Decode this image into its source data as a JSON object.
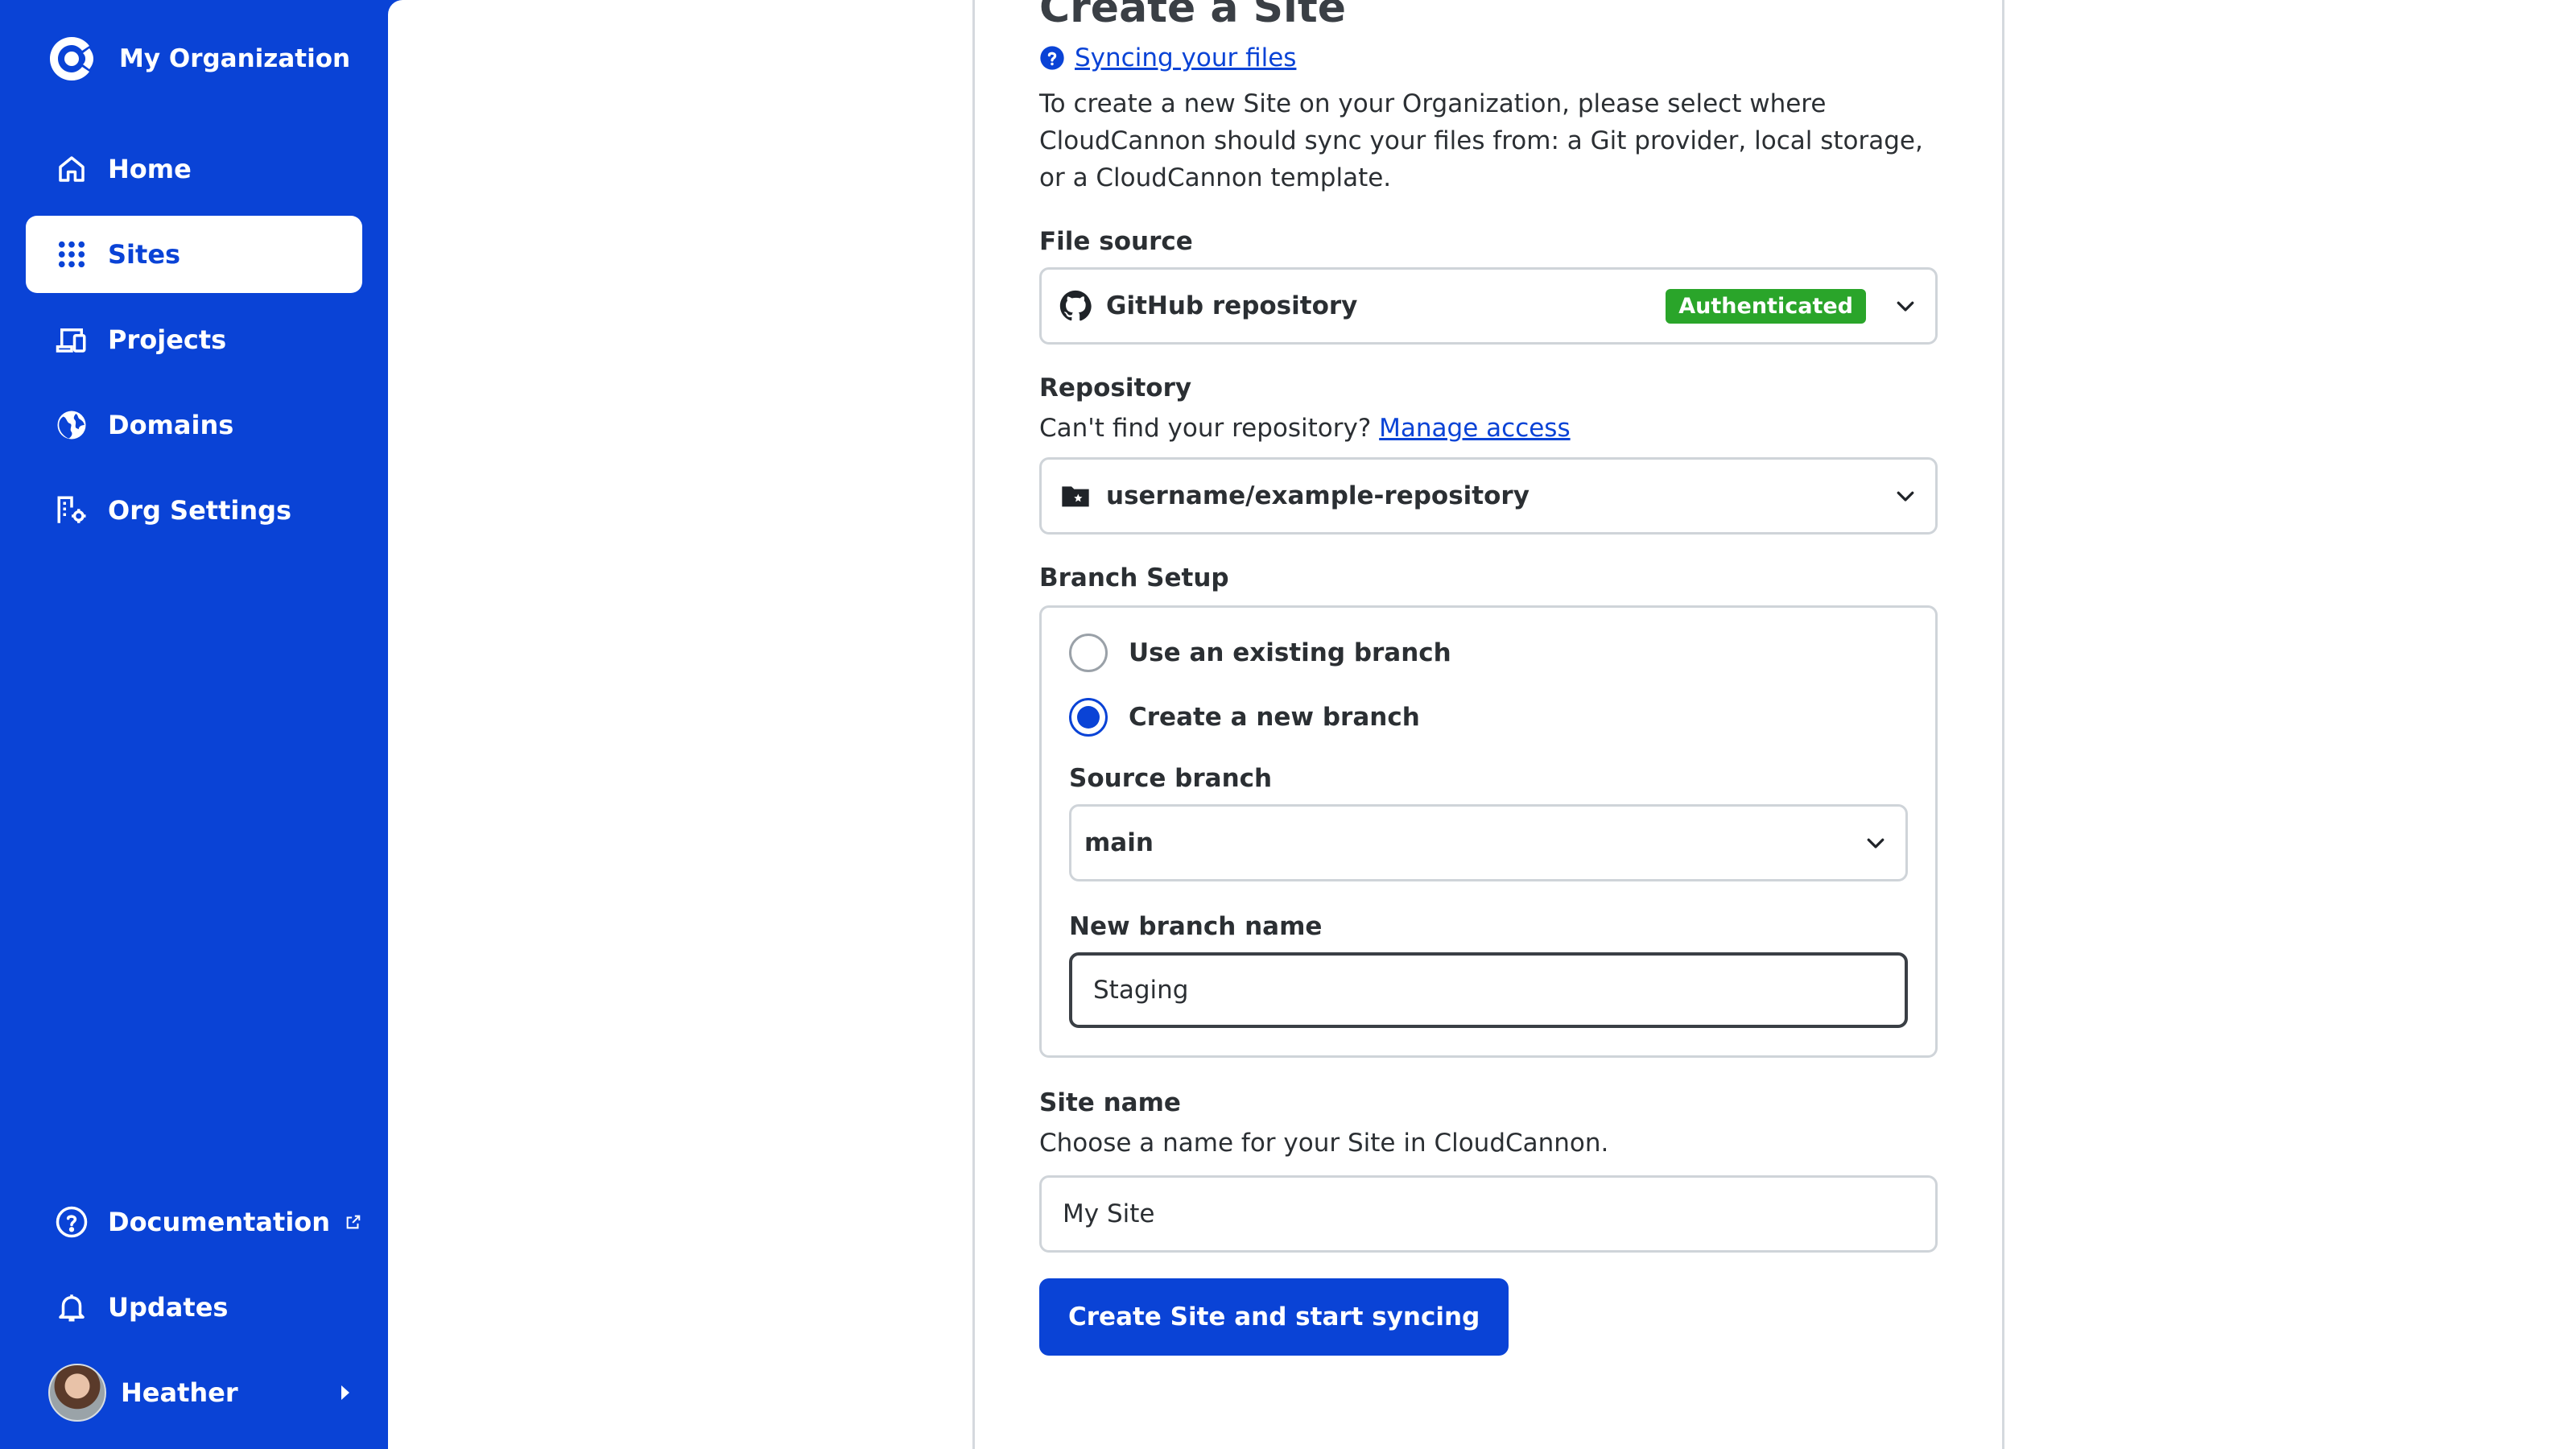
{
  "org": {
    "name": "My Organization",
    "logo_icon": "cloudcannon-logo-icon"
  },
  "sidebar": {
    "items": [
      {
        "label": "Home",
        "icon": "home-icon",
        "active": false
      },
      {
        "label": "Sites",
        "icon": "grid-icon",
        "active": true
      },
      {
        "label": "Projects",
        "icon": "projects-icon",
        "active": false
      },
      {
        "label": "Domains",
        "icon": "globe-icon",
        "active": false
      },
      {
        "label": "Org Settings",
        "icon": "building-gear-icon",
        "active": false
      }
    ],
    "bottom": [
      {
        "label": "Documentation",
        "icon": "question-circle-icon",
        "external": true
      },
      {
        "label": "Updates",
        "icon": "bell-icon",
        "external": false
      }
    ],
    "user": {
      "name": "Heather"
    }
  },
  "form": {
    "title": "Create a Site",
    "help_link": "Syncing your files",
    "intro": "To create a new Site on your Organization, please select where CloudCannon should sync your files from: a Git provider, local storage, or a CloudCannon template.",
    "file_source": {
      "label": "File source",
      "value": "GitHub repository",
      "badge": "Authenticated"
    },
    "repository": {
      "label": "Repository",
      "note": "Can't find your repository?",
      "note_link": "Manage access",
      "value": "username/example-repository"
    },
    "branch": {
      "label": "Branch Setup",
      "options": [
        "Use an existing branch",
        "Create a new branch"
      ],
      "selected_index": 1,
      "source_label": "Source branch",
      "source_value": "main",
      "new_label": "New branch name",
      "new_value": "Staging"
    },
    "site_name": {
      "label": "Site name",
      "note": "Choose a name for your Site in CloudCannon.",
      "value": "My Site"
    },
    "submit_label": "Create Site and start syncing"
  },
  "colors": {
    "brand": "#0a43d6",
    "success": "#2aa52a"
  }
}
